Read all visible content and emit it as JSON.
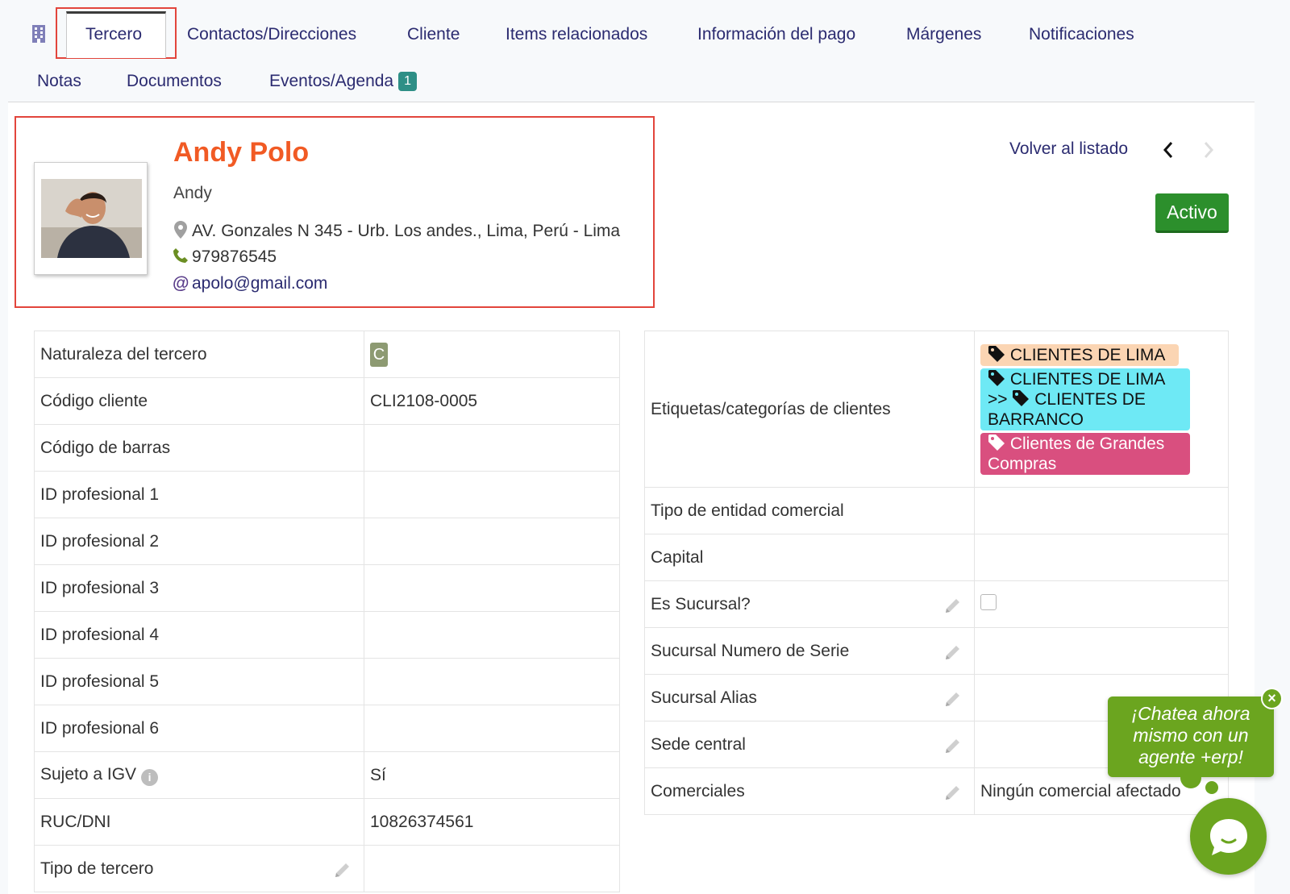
{
  "tabs": {
    "row1": [
      "Tercero",
      "Contactos/Direcciones",
      "Cliente",
      "Items relacionados",
      "Información del pago",
      "Márgenes",
      "Notificaciones"
    ],
    "row2": [
      "Notas",
      "Documentos",
      "Eventos/Agenda"
    ],
    "events_badge": "1"
  },
  "profile": {
    "name": "Andy Polo",
    "alias": "Andy",
    "address": "AV. Gonzales N 345 - Urb. Los andes., Lima, Perú - Lima",
    "phone": "979876545",
    "email": "apolo@gmail.com"
  },
  "header": {
    "back_link": "Volver al listado",
    "status": "Activo"
  },
  "left_fields": [
    {
      "label": "Naturaleza del tercero",
      "value": "C"
    },
    {
      "label": "Código cliente",
      "value": "CLI2108-0005"
    },
    {
      "label": "Código de barras",
      "value": ""
    },
    {
      "label": "ID profesional 1",
      "value": ""
    },
    {
      "label": "ID profesional 2",
      "value": ""
    },
    {
      "label": "ID profesional 3",
      "value": ""
    },
    {
      "label": "ID profesional 4",
      "value": ""
    },
    {
      "label": "ID profesional 5",
      "value": ""
    },
    {
      "label": "ID profesional 6",
      "value": ""
    },
    {
      "label": "Sujeto a IGV",
      "value": "Sí"
    },
    {
      "label": "RUC/DNI",
      "value": "10826374561"
    },
    {
      "label": "Tipo de tercero",
      "value": ""
    }
  ],
  "right_fields": {
    "tags_label": "Etiquetas/categorías de clientes",
    "tags": {
      "t1": "CLIENTES DE LIMA",
      "t2a": "CLIENTES DE LIMA",
      "t2sep": ">>",
      "t2b": "CLIENTES DE BARRANCO",
      "t3": "Clientes de Grandes Compras"
    },
    "rows": [
      {
        "label": "Tipo de entidad comercial",
        "value": ""
      },
      {
        "label": "Capital",
        "value": ""
      },
      {
        "label": "Es Sucursal?",
        "value": ""
      },
      {
        "label": "Sucursal Numero de Serie",
        "value": ""
      },
      {
        "label": "Sucursal Alias",
        "value": ""
      },
      {
        "label": "Sede central",
        "value": ""
      },
      {
        "label": "Comerciales",
        "value": "Ningún comercial afectado"
      }
    ]
  },
  "chat": {
    "line1": "¡Chatea ahora",
    "line2": "mismo con un",
    "line3": "agente +erp!",
    "close": "×"
  },
  "colors": {
    "accent": "#f15a24",
    "link": "#2b2b70",
    "status": "#2c8f2c",
    "chat": "#6ba51f",
    "highlight_border": "#e2453c"
  }
}
